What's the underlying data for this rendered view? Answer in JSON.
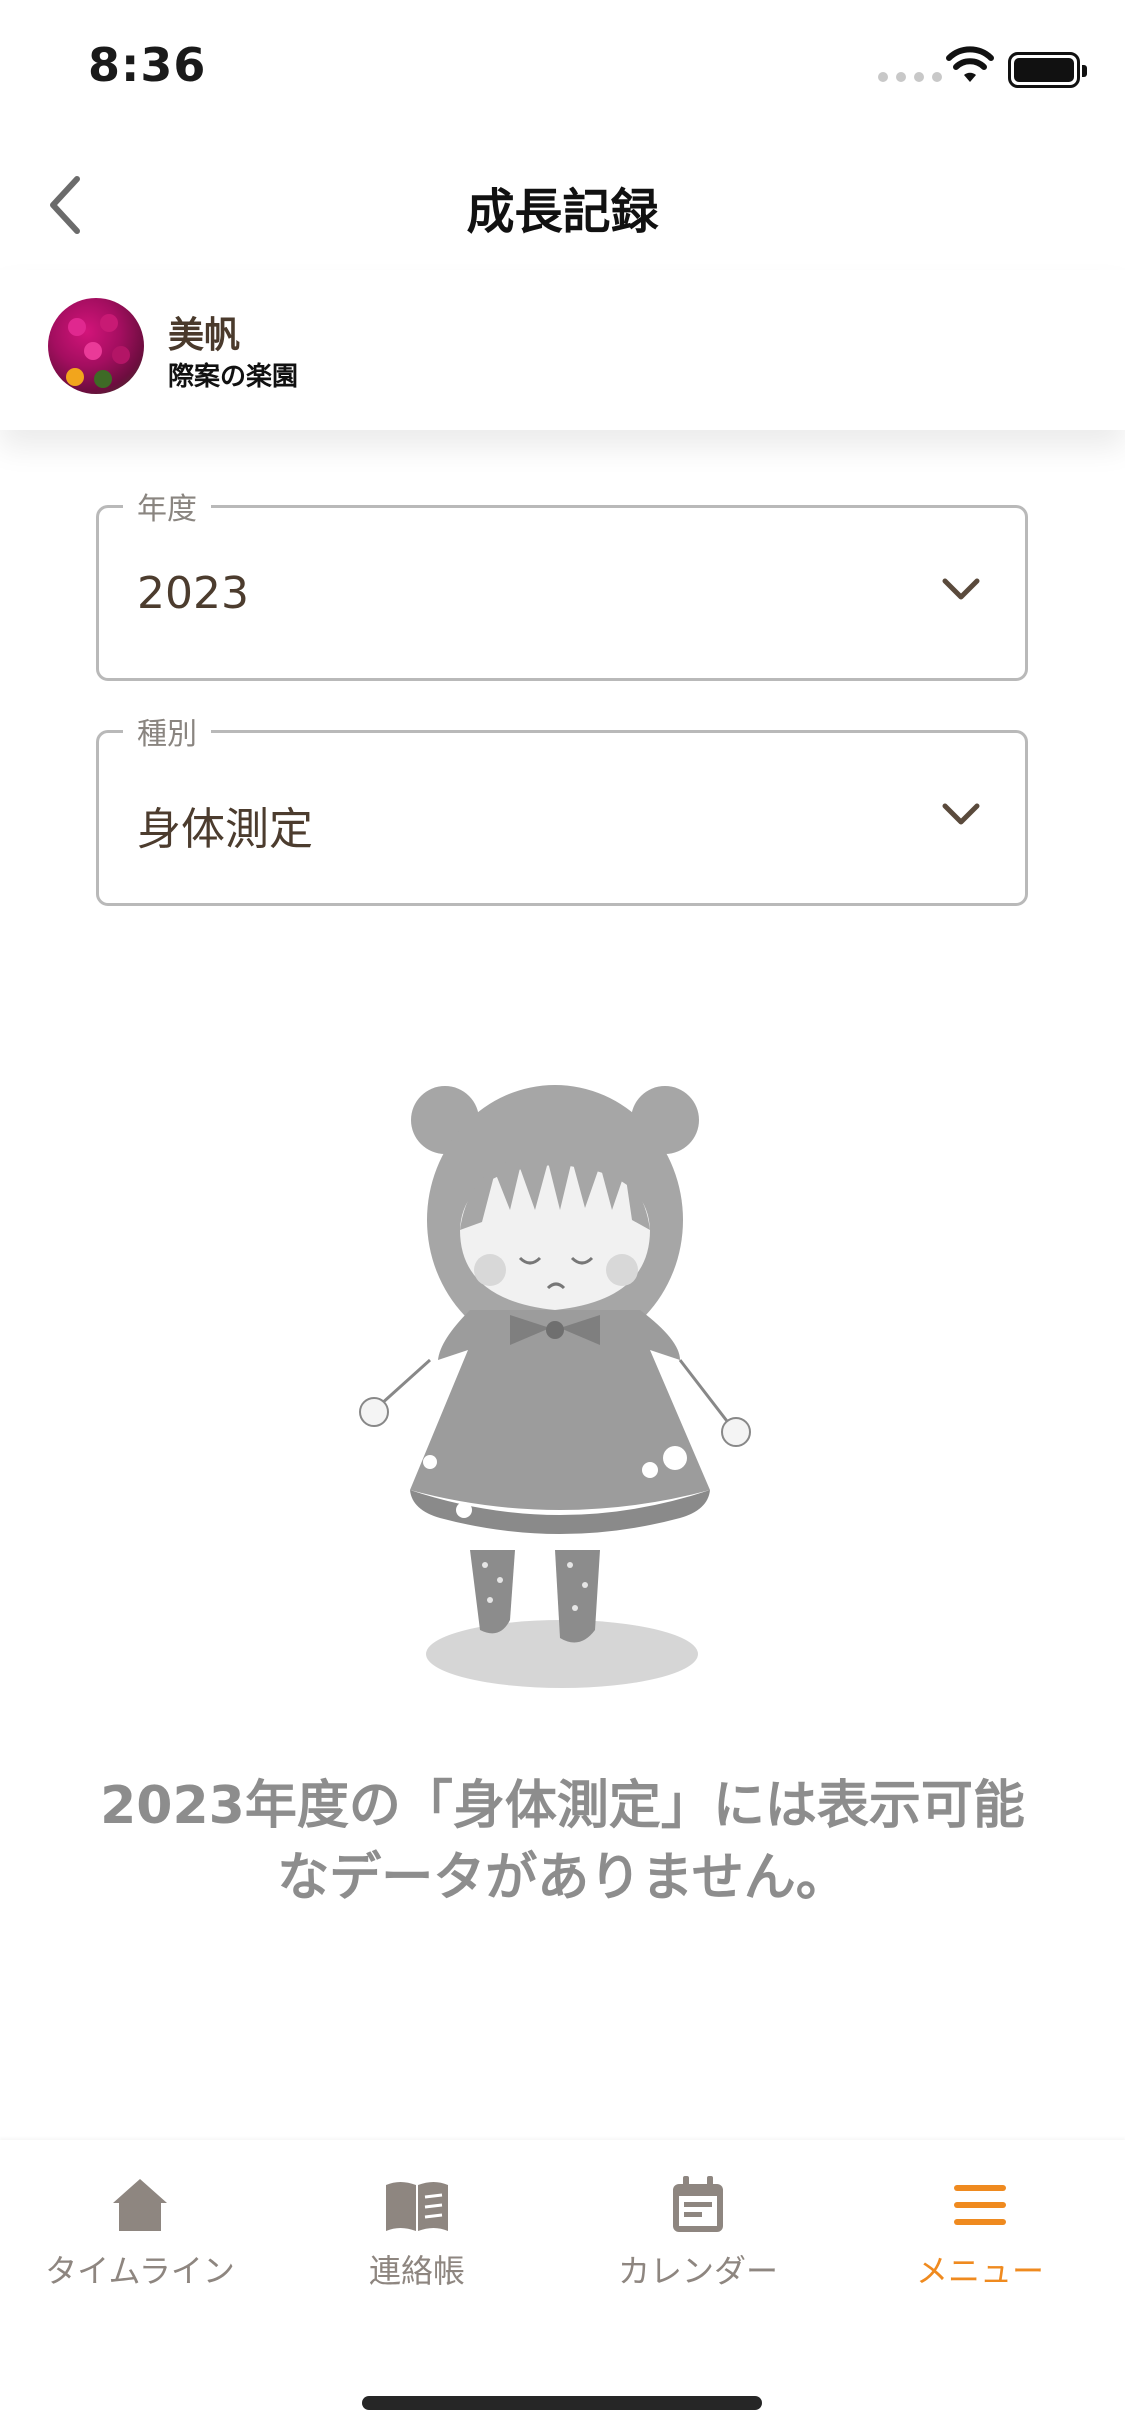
{
  "status_bar": {
    "time": "8:36"
  },
  "header": {
    "title": "成長記録"
  },
  "profile": {
    "name": "美帆",
    "school": "際案の楽園"
  },
  "fields": {
    "year": {
      "label": "年度",
      "value": "2023"
    },
    "type": {
      "label": "種別",
      "value": "身体測定"
    }
  },
  "empty_state": {
    "message": "2023年度の「身体測定」には表示可能なデータがありません。"
  },
  "tabs": [
    {
      "label": "タイムライン",
      "icon": "home-icon"
    },
    {
      "label": "連絡帳",
      "icon": "book-icon"
    },
    {
      "label": "カレンダー",
      "icon": "calendar-icon"
    },
    {
      "label": "メニュー",
      "icon": "menu-icon",
      "active": true
    }
  ],
  "colors": {
    "accent": "#ef8a1f",
    "tab_inactive": "#8e8680",
    "text_brown": "#4c3c2e",
    "message_gray": "#8d8d8d"
  }
}
